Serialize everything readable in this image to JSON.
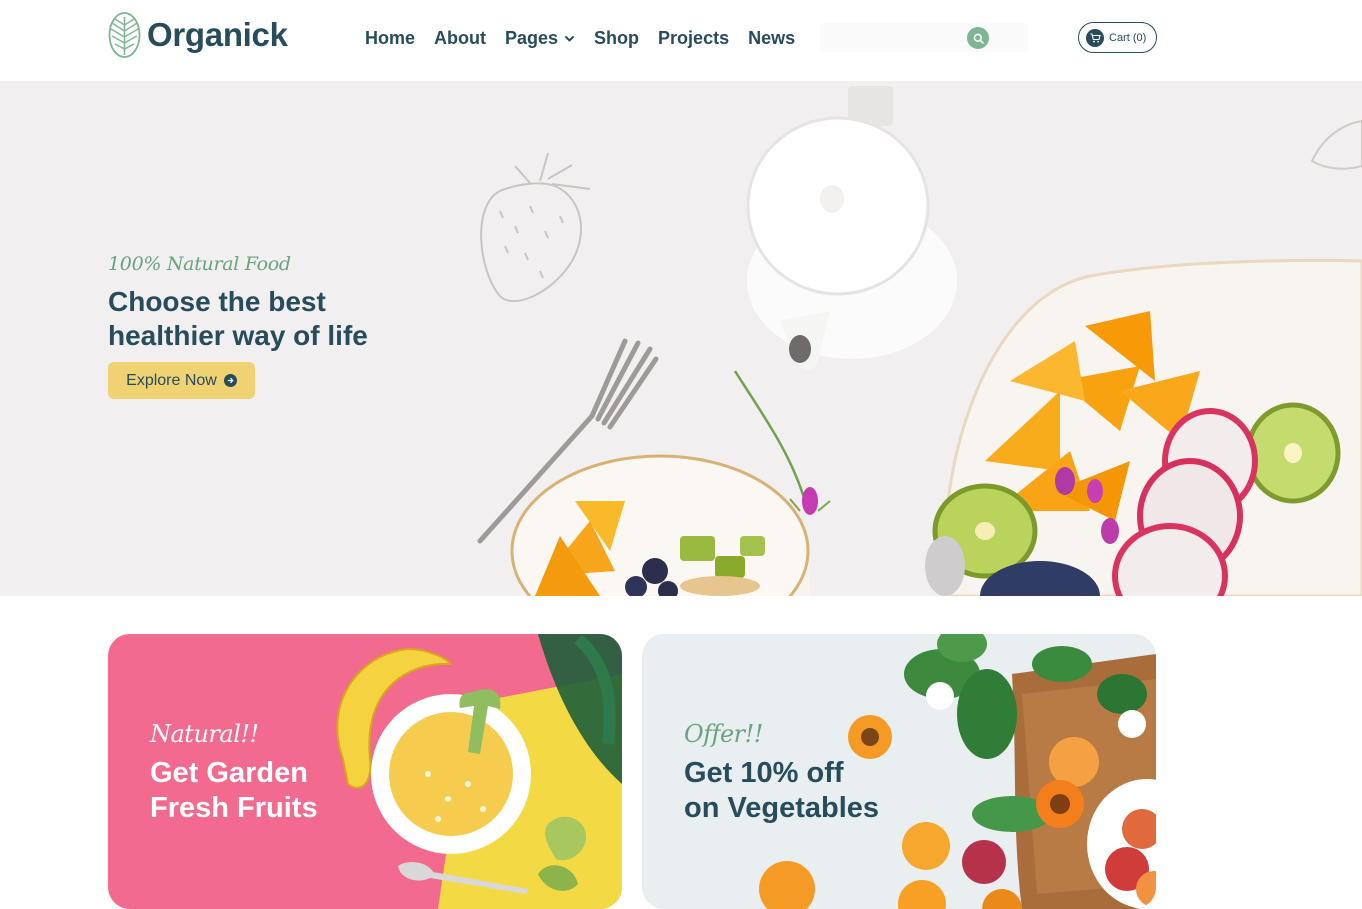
{
  "brand": {
    "name": "Organick",
    "logo_icon": "leaf-logo-icon",
    "primary_color": "#274c5b",
    "accent_green": "#7eb693",
    "accent_yellow": "#efd372"
  },
  "nav": {
    "items": [
      {
        "label": "Home"
      },
      {
        "label": "About"
      },
      {
        "label": "Pages",
        "has_dropdown": true
      },
      {
        "label": "Shop"
      },
      {
        "label": "Projects"
      },
      {
        "label": "News"
      }
    ]
  },
  "search": {
    "placeholder": "",
    "icon": "search-icon"
  },
  "cart": {
    "label": "Cart (0)",
    "count": 0,
    "icon": "cart-icon"
  },
  "hero": {
    "subtitle": "100% Natural Food",
    "title_line1": "Choose the best",
    "title_line2": "healthier way of life",
    "cta_label": "Explore Now",
    "background": "#f1eff0"
  },
  "promos": [
    {
      "tag": "Natural!!",
      "title_line1": "Get Garden",
      "title_line2": "Fresh Fruits",
      "background": "#f26a8d"
    },
    {
      "tag": "Offer!!",
      "title_line1": "Get 10% off",
      "title_line2": "on Vegetables",
      "background": "#e9eef1"
    }
  ]
}
